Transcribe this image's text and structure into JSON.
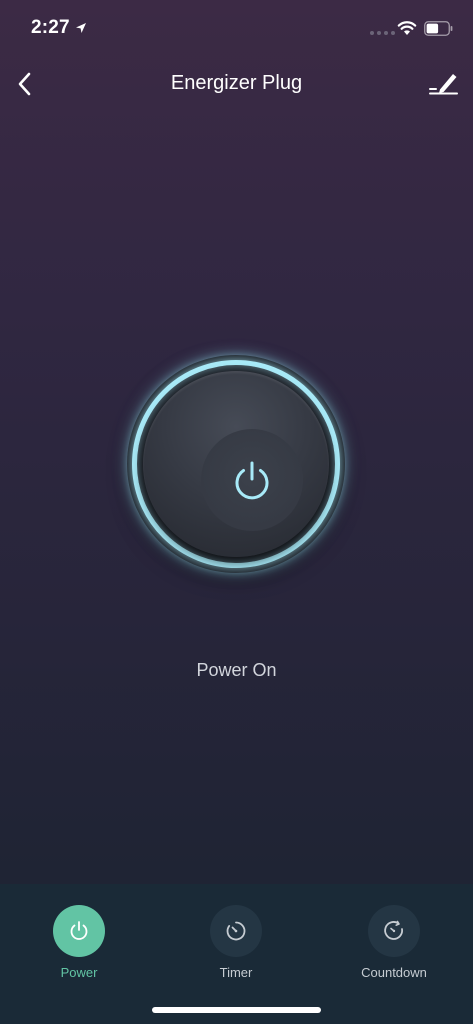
{
  "status_bar": {
    "time": "2:27",
    "icons": [
      "location-arrow-icon",
      "signal-icon",
      "wifi-icon",
      "battery-icon"
    ],
    "battery_level": 0.5
  },
  "nav": {
    "title": "Energizer Plug",
    "back_icon": "chevron-left-icon",
    "edit_icon": "pencil-icon"
  },
  "main": {
    "power_state": "Power On",
    "ring_color": "#a8eaf8"
  },
  "tabs": [
    {
      "label": "Power",
      "icon": "power-icon",
      "active": true
    },
    {
      "label": "Timer",
      "icon": "timer-icon",
      "active": false
    },
    {
      "label": "Countdown",
      "icon": "countdown-icon",
      "active": false
    }
  ],
  "colors": {
    "accent": "#62c4a4",
    "tab_bar_bg": "#1a2a37",
    "ring_glow": "#a8eaf8"
  }
}
